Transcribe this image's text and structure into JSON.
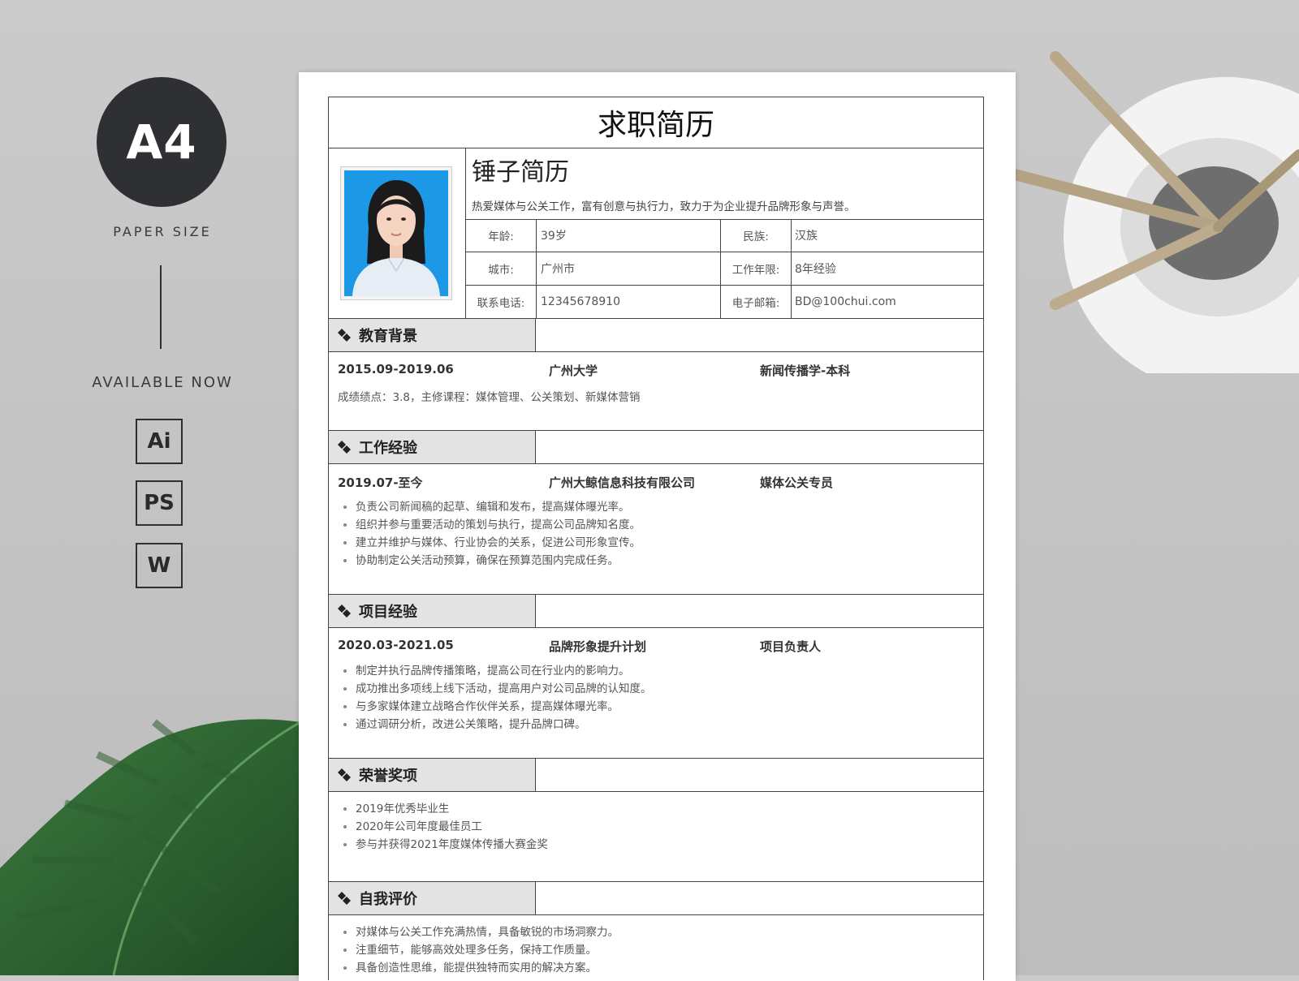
{
  "promo": {
    "paper_code": "A4",
    "paper_size_label": "PAPER SIZE",
    "available_label": "AVAILABLE NOW",
    "formats": [
      "Ai",
      "PS",
      "W"
    ]
  },
  "resume": {
    "doc_title": "求职简历",
    "name": "锤子简历",
    "slogan": "热爱媒体与公关工作，富有创意与执行力，致力于为企业提升品牌形象与声誉。",
    "info": [
      {
        "label1": "年龄:",
        "value1": "39岁",
        "label2": "民族:",
        "value2": "汉族"
      },
      {
        "label1": "城市:",
        "value1": "广州市",
        "label2": "工作年限:",
        "value2": "8年经验"
      },
      {
        "label1": "联系电话:",
        "value1": "12345678910",
        "label2": "电子邮箱:",
        "value2": "BD@100chui.com"
      }
    ],
    "education": {
      "title": "教育背景",
      "period": "2015.09-2019.06",
      "school": "广州大学",
      "major": "新闻传播学-本科",
      "detail": "成绩绩点：3.8，主修课程：媒体管理、公关策划、新媒体营销"
    },
    "work": {
      "title": "工作经验",
      "period": "2019.07-至今",
      "company": "广州大鲸信息科技有限公司",
      "position": "媒体公关专员",
      "items": [
        "负责公司新闻稿的起草、编辑和发布，提高媒体曝光率。",
        "组织并参与重要活动的策划与执行，提高公司品牌知名度。",
        "建立并维护与媒体、行业协会的关系，促进公司形象宣传。",
        "协助制定公关活动预算，确保在预算范围内完成任务。"
      ]
    },
    "project": {
      "title": "项目经验",
      "period": "2020.03-2021.05",
      "name": "品牌形象提升计划",
      "role": "项目负责人",
      "items": [
        "制定并执行品牌传播策略，提高公司在行业内的影响力。",
        "成功推出多项线上线下活动，提高用户对公司品牌的认知度。",
        "与多家媒体建立战略合作伙伴关系，提高媒体曝光率。",
        "通过调研分析，改进公关策略，提升品牌口碑。"
      ]
    },
    "awards": {
      "title": "荣誉奖项",
      "items": [
        "2019年优秀毕业生",
        "2020年公司年度最佳员工",
        "参与并获得2021年度媒体传播大赛金奖"
      ]
    },
    "self": {
      "title": "自我评价",
      "items": [
        "对媒体与公关工作充满热情，具备敏锐的市场洞察力。",
        "注重细节，能够高效处理多任务，保持工作质量。",
        "具备创造性思维，能提供独特而实用的解决方案。"
      ]
    }
  },
  "colors": {
    "section_header_bg": "#e3e3e3",
    "photo_background": "#1d98e6",
    "badge_dark": "#2f3033"
  }
}
